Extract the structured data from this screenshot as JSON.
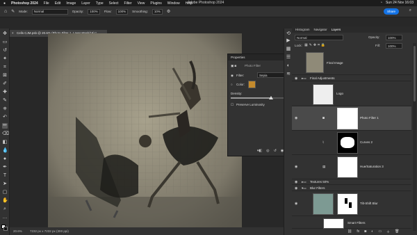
{
  "menubar": {
    "app": "Photoshop 2024",
    "items": [
      "File",
      "Edit",
      "Image",
      "Layer",
      "Type",
      "Select",
      "Filter",
      "View",
      "Plugins",
      "Window",
      "Help"
    ],
    "center_title": "Adobe Photoshop 2024",
    "datetime": "Sun 24 Nov 16:03"
  },
  "options": {
    "mode_label": "Mode:",
    "mode_value": "Normal",
    "opacity_label": "Opacity:",
    "opacity_value": "100%",
    "flow_label": "Flow:",
    "flow_value": "100%",
    "smoothing_label": "Smoothing:",
    "smoothing_value": "10%",
    "share_label": "Share"
  },
  "document": {
    "tab_title": "Cells CJM.psb @ 20.6% (Photo Filter 1, Layer Mask/16) *",
    "zoom": "20.6%",
    "size_info": "7232 px x 7232 px (300 ppi)"
  },
  "properties": {
    "title": "Properties",
    "subtitle": "Photo Filter",
    "filter_label": "Filter:",
    "filter_value": "Sepia",
    "color_label": "Color:",
    "color_swatch": "#c48a2c",
    "density_label": "Density:",
    "density_value": "58",
    "density_unit": "%",
    "density_fraction": 0.58,
    "preserve_label": "Preserve Luminosity"
  },
  "panel": {
    "tabs": [
      "Histogram",
      "Navigator",
      "Layers"
    ],
    "blend": "Normal",
    "opacity_label": "Opacity:",
    "opacity_value": "100%",
    "lock_label": "Lock:",
    "fill_label": "Fill:",
    "fill_value": "100%"
  },
  "layers": [
    {
      "name": "Final Image"
    },
    {
      "name": "Final Adjustments"
    },
    {
      "name": "Logo"
    },
    {
      "name": "Photo Filter 1"
    },
    {
      "name": "Curves 2"
    },
    {
      "name": "Hue/Saturation 3"
    },
    {
      "name": "Textures 50%"
    },
    {
      "name": "Blur Filters"
    },
    {
      "name": "Tilt-Shift Blur"
    },
    {
      "name": "Smart Filters"
    }
  ]
}
